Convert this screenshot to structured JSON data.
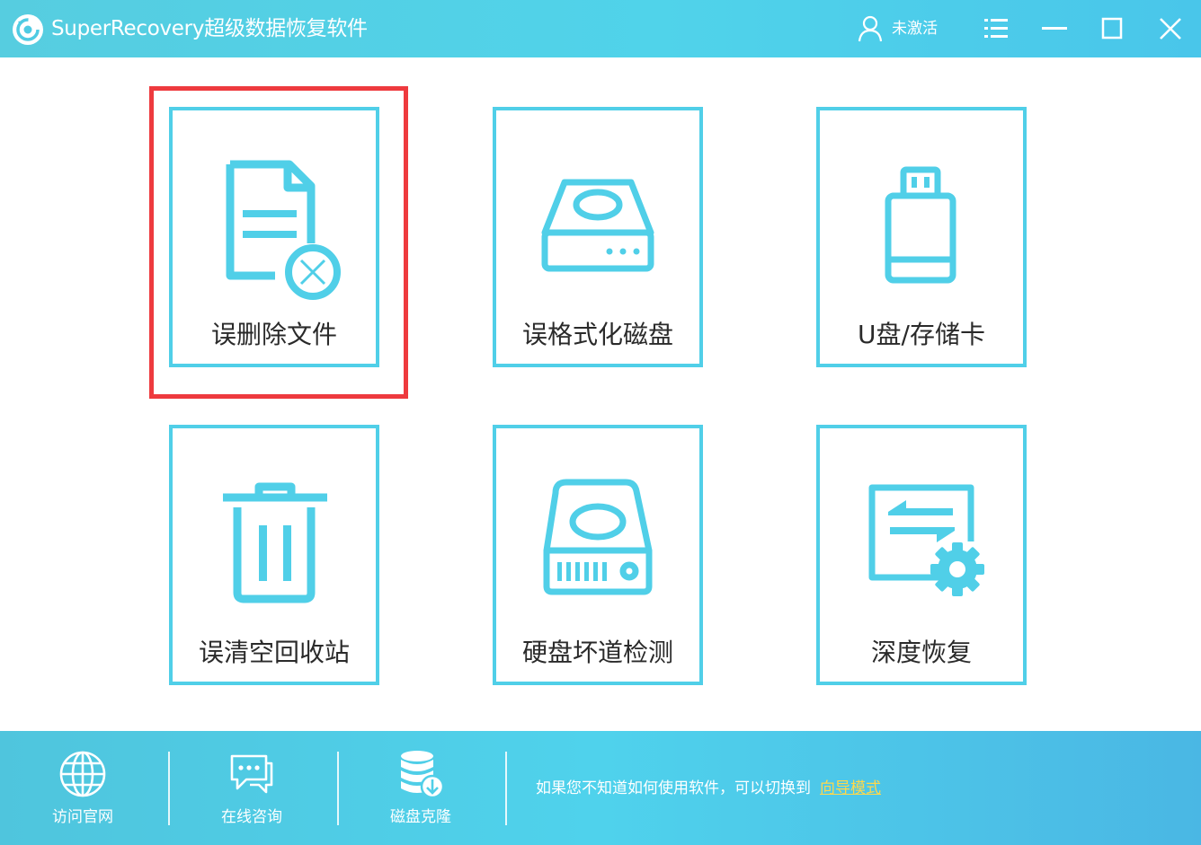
{
  "window": {
    "title": "SuperRecovery超级数据恢复软件",
    "user_status": "未激活"
  },
  "tiles": [
    {
      "label": "误删除文件",
      "icon": "deleted-file-icon",
      "selected": true
    },
    {
      "label": "误格式化磁盘",
      "icon": "disk-drive-icon"
    },
    {
      "label": "U盘/存储卡",
      "icon": "usb-drive-icon"
    },
    {
      "label": "误清空回收站",
      "icon": "recycle-bin-icon"
    },
    {
      "label": "硬盘坏道检测",
      "icon": "hard-disk-icon"
    },
    {
      "label": "深度恢复",
      "icon": "deep-recovery-icon"
    }
  ],
  "footer": {
    "items": [
      {
        "label": "访问官网",
        "icon": "globe-icon"
      },
      {
        "label": "在线咨询",
        "icon": "chat-icon"
      },
      {
        "label": "磁盘克隆",
        "icon": "database-icon"
      }
    ],
    "hint_text": "如果您不知道如何使用软件，可以切换到",
    "wizard_link": "向导模式"
  },
  "colors": {
    "accent": "#50cfe8",
    "highlight": "#ee3a3e",
    "link": "#ffd84a"
  }
}
